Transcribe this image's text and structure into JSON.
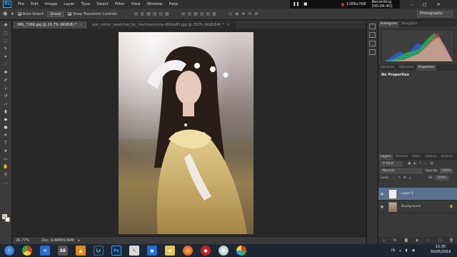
{
  "menubar": {
    "logo": "Ps",
    "items": [
      "File",
      "Edit",
      "Image",
      "Layer",
      "Type",
      "Select",
      "Filter",
      "View",
      "Window",
      "Help"
    ]
  },
  "recorder": {
    "resolution": "1366x768",
    "status": "Recording [00:09:40]"
  },
  "window_controls": {
    "minimize": "–",
    "maximize": "□",
    "close": "✕"
  },
  "options_bar": {
    "auto_select_label": "Auto-Select:",
    "auto_select_target": "Group",
    "show_transform_label": "Show Transform Controls",
    "workspace": "Photography"
  },
  "tabs": [
    {
      "label": "IMG_7266.jpg @ 26,7% (RGB/8) *",
      "active": true
    },
    {
      "label": "eye_colour_swatches_by_marinavictoria-d60sb85.jpg @ 253% (RGB/8#) *",
      "active": false
    }
  ],
  "status_bar": {
    "zoom": "26,77%",
    "doc": "Doc: 9,66M/9,66M"
  },
  "histogram_panel": {
    "tabs": [
      "Histogram",
      "Navigator"
    ]
  },
  "properties_panel": {
    "tabs": [
      "Libraries",
      "Adjustme",
      "Properties"
    ],
    "empty_text": "No Properties"
  },
  "layers_panel": {
    "tabs": [
      "Layers",
      "Channe",
      "Paths",
      "History",
      "Actions"
    ],
    "filter_kind": "Kind",
    "blend_mode": "Normal",
    "opacity_label": "Opacity:",
    "opacity_value": "100%",
    "lock_label": "Lock:",
    "fill_label": "Fill:",
    "fill_value": "100%",
    "layers": [
      {
        "name": "Layer 1",
        "selected": true
      },
      {
        "name": "Background",
        "selected": false
      }
    ]
  },
  "colors": {
    "foreground": "#f2c38e",
    "background": "#ffffff",
    "selection": "#58728f"
  },
  "taskbar": {
    "apps": [
      "start-orb",
      "chrome-icon",
      "mail-icon",
      "se-icon",
      "media-icon",
      "lightroom-icon",
      "photoshop-icon",
      "paint-icon",
      "photos-icon",
      "explorer-icon",
      "firefox-icon",
      "recorder-icon",
      "browser-icon",
      "camera-icon"
    ],
    "se_label": "SE",
    "lr_label": "Lr",
    "ps_label": "Ps",
    "language": "IN",
    "time": "15:35",
    "date": "30/05/2016"
  }
}
